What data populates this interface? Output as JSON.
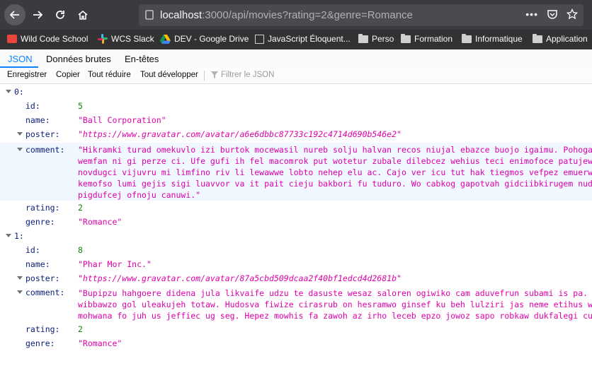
{
  "browser": {
    "url_host": "localhost",
    "url_rest": ":3000/api/movies?rating=2&genre=Romance",
    "bookmarks": [
      "Wild Code School",
      "WCS Slack",
      "DEV - Google Drive",
      "JavaScript Éloquent...",
      "Perso",
      "Formation",
      "Informatique",
      "Application"
    ]
  },
  "viewer": {
    "tabs": [
      "JSON",
      "Données brutes",
      "En-têtes"
    ],
    "actions": [
      "Enregistrer",
      "Copier",
      "Tout réduire",
      "Tout développer"
    ],
    "filter_placeholder": "Filtrer le JSON"
  },
  "json": {
    "items": [
      {
        "index": "0:",
        "id_key": "id:",
        "id": "5",
        "name_key": "name:",
        "name": "\"Ball Corporation\"",
        "poster_key": "poster:",
        "poster": "\"https://www.gravatar.com/avatar/a6e6dbbc87733c192c4714d690b546e2\"",
        "comment_key": "comment:",
        "comment_lines": [
          "\"Hikramki turad omekuvlo izi burtok mocewasil nureb solju halvan recos niujal ebazce buojo igaimu. Pohogag mom",
          "wemfan ni gi perze ci. Ufe gufi ih fel macomrok put wotetur zubale dilebcez wehius teci enimofoce patujew duzi",
          "novdugci vijuvru mi limfino riv li lewawwe lobto nehep elu ac. Cajo ver icu tut hak tiegmos vefpez emuerwil vo",
          "kemofso lumi gejis sigi luavvor va it pait cieju bakbori fu tuduro. Wo cabkog gapotvah gidciibkirugem nudemigi",
          "pigdufcej ofnoju canuwi.\""
        ],
        "rating_key": "rating:",
        "rating": "2",
        "genre_key": "genre:",
        "genre": "\"Romance\""
      },
      {
        "index": "1:",
        "id_key": "id:",
        "id": "8",
        "name_key": "name:",
        "name": "\"Phar Mor Inc.\"",
        "poster_key": "poster:",
        "poster": "\"https://www.gravatar.com/avatar/87a5cbd509dcaa2f40bf1edcd4d2681b\"",
        "comment_key": "comment:",
        "comment_lines": [
          "\"Bupipzu hahgoere didena jula likvaife udzu te dasuste wesaz saloren ogiwiko cam aduvefrun subami is pa. Gupil",
          "wibbawzo gol uleakujeh totaw. Hudosva fiwize cirasrub on hesramwo ginsef ku beh lulziri jas neme etihus wujo l",
          "mohwana fo juh us jeffiec ug seg. Hepez mowhis fa zawoh az irho leceb epzo jowoz sapo robkaw dukfalegi cuepu o"
        ],
        "rating_key": "rating:",
        "rating": "2",
        "genre_key": "genre:",
        "genre": "\"Romance\""
      }
    ]
  }
}
